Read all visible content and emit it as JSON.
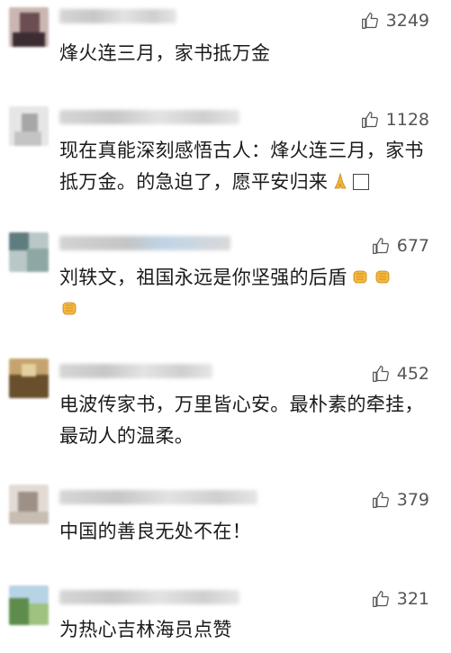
{
  "comments": [
    {
      "likes": "3249",
      "text": "烽火连三月，家书抵万金",
      "emojis": [],
      "avatar_colors": [
        "#7a5a5a",
        "#c9b3ad",
        "#3c2d33",
        "#e8e0de"
      ]
    },
    {
      "likes": "1128",
      "text": "现在真能深刻感悟古人：烽火连三月，家书抵万金。的急迫了，愿平安归来",
      "emojis": [
        "pray-emoji",
        "box-emoji"
      ],
      "avatar_colors": [
        "#d9d9d9",
        "#a9a9a9",
        "#efefef",
        "#bcbcbc"
      ]
    },
    {
      "likes": "677",
      "text": "刘轶文，祖国永远是你坚强的后盾",
      "emojis": [
        "fist-emoji",
        "fist-emoji",
        "fist-emoji"
      ],
      "avatar_colors": [
        "#6f8a86",
        "#c7d3d2",
        "#3f5a60",
        "#9fb5b2"
      ]
    },
    {
      "likes": "452",
      "text": "电波传家书，万里皆心安。最朴素的牵挂，最动人的温柔。",
      "emojis": [],
      "avatar_colors": [
        "#8a6a3a",
        "#c4a774",
        "#4a3a22",
        "#e0c89a"
      ]
    },
    {
      "likes": "379",
      "text": "中国的善良无处不在！",
      "emojis": [],
      "avatar_colors": [
        "#c9c0b8",
        "#8d8177",
        "#efe9e4",
        "#a89c92"
      ]
    },
    {
      "likes": "321",
      "text": "为热心吉林海员点赞",
      "emojis": [],
      "avatar_colors": [
        "#7ab0d6",
        "#4e7a45",
        "#bcd8ea",
        "#8fb46f"
      ]
    }
  ],
  "icons": {
    "like": "thumbs-up-icon"
  }
}
